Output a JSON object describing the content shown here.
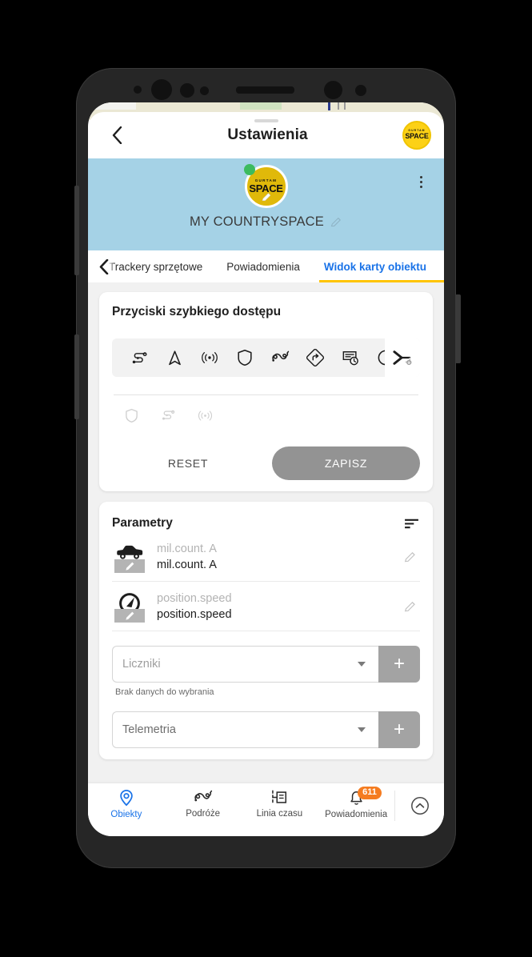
{
  "appbar": {
    "back_icon": "chevron-left-icon",
    "title": "Ustawienia",
    "logo_top": "GURTAM",
    "logo_main": "SPACE"
  },
  "profile": {
    "avatar_top": "GURTAM",
    "avatar_main": "SPACE",
    "name": "MY COUNTRYSPACE",
    "edit_icon": "pencil-icon",
    "menu_icon": "kebab-menu-icon",
    "status": "online",
    "band_color": "#a5d2e6",
    "brand_color": "#e0b90a"
  },
  "tabs": {
    "items": [
      {
        "label": "Trackery sprzętowe",
        "active": false
      },
      {
        "label": "Powiadomienia",
        "active": false
      },
      {
        "label": "Widok karty obiektu",
        "active": true
      }
    ],
    "active_color": "#1a73e8",
    "indicator_color": "#ffc400"
  },
  "quick_access": {
    "title": "Przyciski szybkiego dostępu",
    "active_icons": [
      "route-icon",
      "navigation-arrow-icon",
      "broadcast-signal-icon",
      "shield-icon",
      "trip-track-icon",
      "turn-arrow-icon",
      "report-clock-icon",
      "info-circle-icon"
    ],
    "more_icon": "chevron-right-settings-icon",
    "inactive_icons": [
      "shield-icon",
      "route-icon",
      "broadcast-signal-icon"
    ],
    "reset_label": "RESET",
    "save_label": "ZAPISZ",
    "save_color": "#939393"
  },
  "parameters": {
    "title": "Parametry",
    "sort_icon": "sort-descending-icon",
    "rows": [
      {
        "icon": "car-icon",
        "key": "mil.count. A",
        "value": "mil.count. A",
        "edit_icon": "pencil-icon"
      },
      {
        "icon": "speedometer-icon",
        "key": "position.speed",
        "value": "position.speed",
        "edit_icon": "pencil-icon"
      }
    ],
    "counters_select": {
      "placeholder": "Liczniki",
      "caret_icon": "chevron-down-icon",
      "add_icon": "plus-icon",
      "helper": "Brak danych do wybrania"
    },
    "telemetry_select": {
      "placeholder": "Telemetria",
      "caret_icon": "chevron-down-icon",
      "add_icon": "plus-icon"
    }
  },
  "bottom_nav": {
    "items": [
      {
        "label": "Obiekty",
        "icon": "map-pin-icon",
        "active": true
      },
      {
        "label": "Podróże",
        "icon": "trip-track-icon",
        "active": false
      },
      {
        "label": "Linia czasu",
        "icon": "timeline-icon",
        "active": false
      },
      {
        "label": "Powiadomienia",
        "icon": "bell-icon",
        "active": false,
        "badge": "611"
      }
    ],
    "expand_icon": "chevron-up-circle-icon",
    "badge_color": "#f57c20",
    "active_color": "#1a73e8"
  }
}
